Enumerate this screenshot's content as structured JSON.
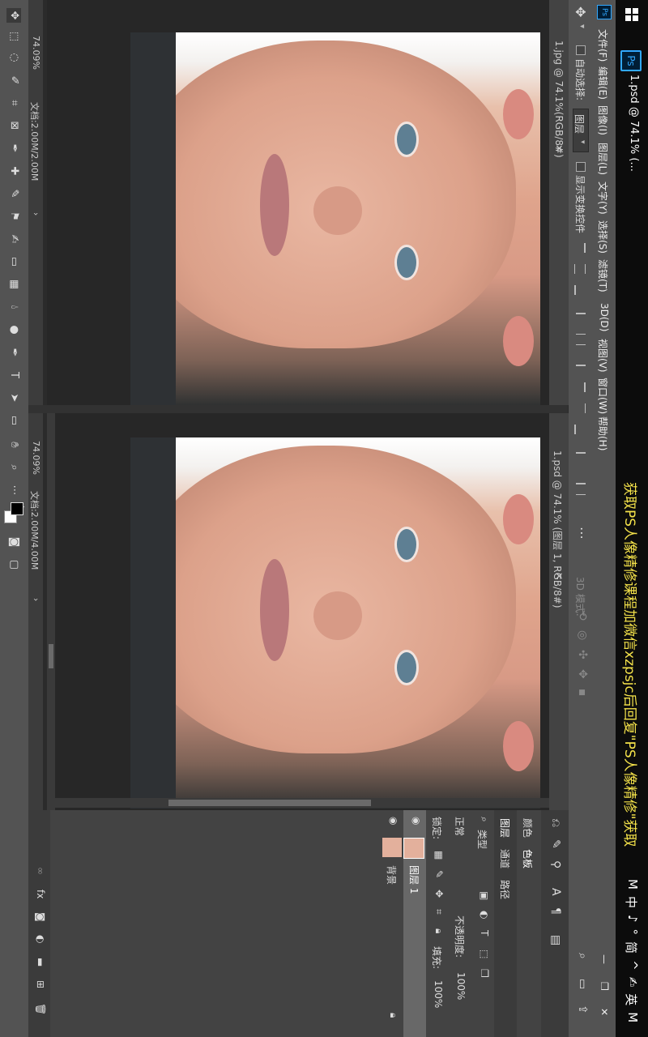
{
  "taskbar": {
    "start_icon": "windows-logo-icon",
    "app_badge": "Ps",
    "app_title": "1.psd @ 74.1% (...",
    "promo_text": "获取PS人像精修课程加微信xzpsjc后回复\"PS人像精修\"获取",
    "tray": [
      "M",
      "中",
      "♪",
      "°",
      "简",
      "^",
      "✍",
      "英",
      "M"
    ],
    "tray_color_accent": "#f4e24a"
  },
  "menubar": {
    "ps_icon": "Ps",
    "items": [
      "文件(F)",
      "编辑(E)",
      "图像(I)",
      "图层(L)",
      "文字(Y)",
      "选择(S)",
      "滤镜(T)",
      "3D(D)",
      "视图(V)",
      "窗口(W)",
      "帮助(H)"
    ],
    "window_controls": [
      "—",
      "❐",
      "✕"
    ]
  },
  "options": {
    "auto_select_label": "自动选择:",
    "layer_dropdown": "图层",
    "show_transform_label": "显示变换控件",
    "mode_3d_label": "3D 模式:"
  },
  "doc1": {
    "tab_title": "1.jpg @ 74.1%(RGB/8#)",
    "zoom": "74.09%",
    "doc_size": "文档:2.00M/2.00M"
  },
  "doc2": {
    "tab_title": "1.psd @ 74.1% (图层 1, RGB/8#)",
    "zoom": "74.09%",
    "doc_size": "文档:2.00M/4.00M"
  },
  "panel": {
    "top_tabs": [
      "颜色",
      "色板"
    ],
    "sub_tabs": [
      "图层",
      "通道",
      "路径"
    ],
    "filter_label": "类型",
    "blend_mode": "正常",
    "opacity_label": "不透明度:",
    "opacity_value": "100%",
    "lock_label": "锁定:",
    "fill_label": "填充:",
    "fill_value": "100%",
    "layers": [
      {
        "name": "图层 1",
        "selected": true
      },
      {
        "name": "背景",
        "selected": false
      }
    ]
  }
}
